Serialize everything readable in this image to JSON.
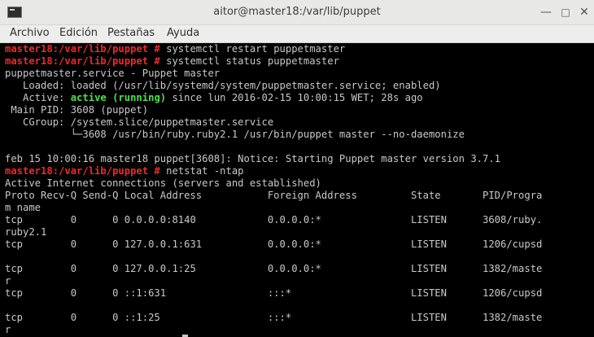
{
  "window": {
    "title": "aitor@master18:/var/lib/puppet",
    "minimize_glyph": "—",
    "maximize_glyph": "□",
    "close_glyph": "✕",
    "icon": "terminal-icon"
  },
  "menubar": [
    "Archivo",
    "Edición",
    "Pestañas",
    "Ayuda"
  ],
  "colors": {
    "prompt": "#ef2929",
    "active": "#4ee04e",
    "text": "#c8c8c8",
    "background": "#000000"
  },
  "terminal": {
    "lines": [
      [
        {
          "t": "master18:/var/lib/puppet # ",
          "s": "prompt"
        },
        {
          "t": "systemctl restart puppetmaster"
        }
      ],
      [
        {
          "t": "master18:/var/lib/puppet # ",
          "s": "prompt"
        },
        {
          "t": "systemctl status puppetmaster"
        }
      ],
      [
        {
          "t": "puppetmaster.service - Puppet master"
        }
      ],
      [
        {
          "t": "   Loaded: loaded (/usr/lib/systemd/system/puppetmaster.service; enabled)"
        }
      ],
      [
        {
          "t": "   Active: "
        },
        {
          "t": "active (running)",
          "s": "active"
        },
        {
          "t": " since lun 2016-02-15 10:00:15 WET; 28s ago"
        }
      ],
      [
        {
          "t": " Main PID: 3608 (puppet)"
        }
      ],
      [
        {
          "t": "   CGroup: /system.slice/puppetmaster.service"
        }
      ],
      [
        {
          "t": "           └─3608 /usr/bin/ruby.ruby2.1 /usr/bin/puppet master --no-daemonize"
        }
      ],
      [
        {
          "t": ""
        }
      ],
      [
        {
          "t": "feb 15 10:00:16 master18 puppet[3608]: Notice: Starting Puppet master version 3.7.1"
        }
      ],
      [
        {
          "t": "master18:/var/lib/puppet # ",
          "s": "prompt"
        },
        {
          "t": "netstat -ntap"
        }
      ],
      [
        {
          "t": "Active Internet connections (servers and established)"
        }
      ],
      [
        {
          "t": "Proto Recv-Q Send-Q Local Address           Foreign Address         State       PID/Progra"
        }
      ],
      [
        {
          "t": "m name"
        }
      ],
      [
        {
          "t": "tcp        0      0 0.0.0.0:8140            0.0.0.0:*               LISTEN      3608/ruby."
        }
      ],
      [
        {
          "t": "ruby2.1"
        }
      ],
      [
        {
          "t": "tcp        0      0 127.0.0.1:631           0.0.0.0:*               LISTEN      1206/cupsd"
        }
      ],
      [
        {
          "t": ""
        }
      ],
      [
        {
          "t": "tcp        0      0 127.0.0.1:25            0.0.0.0:*               LISTEN      1382/maste"
        }
      ],
      [
        {
          "t": "r"
        }
      ],
      [
        {
          "t": "tcp        0      0 ::1:631                 :::*                    LISTEN      1206/cupsd"
        }
      ],
      [
        {
          "t": ""
        }
      ],
      [
        {
          "t": "tcp        0      0 ::1:25                  :::*                    LISTEN      1382/maste"
        }
      ],
      [
        {
          "t": "r"
        }
      ]
    ]
  }
}
